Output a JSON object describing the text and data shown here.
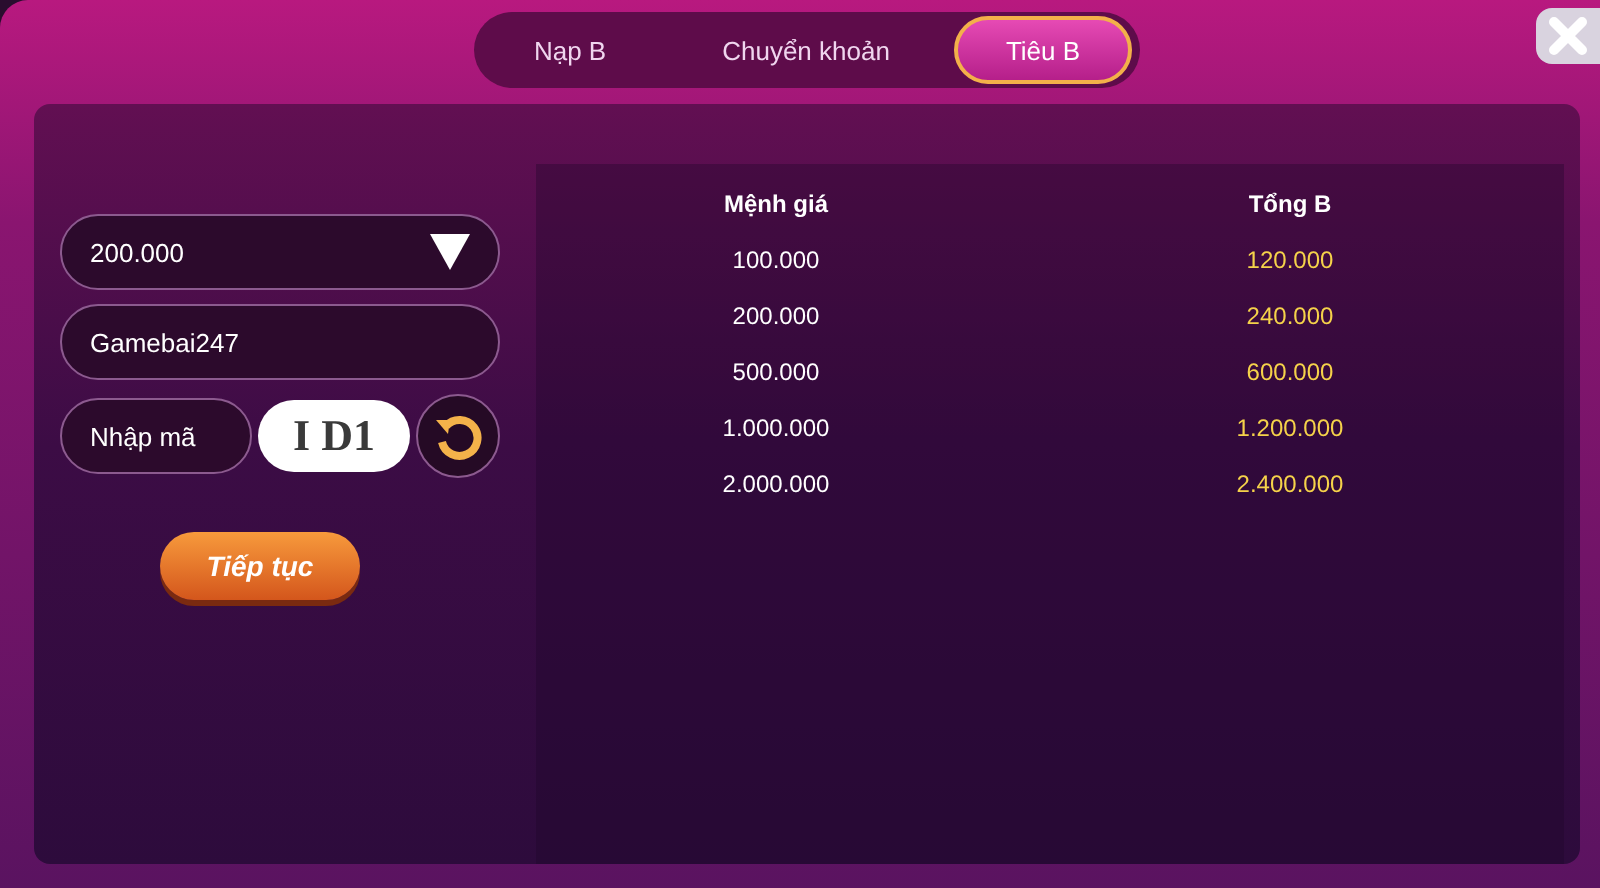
{
  "tabs": [
    {
      "label": "Nạp B",
      "selected": false
    },
    {
      "label": "Chuyển khoản",
      "selected": false
    },
    {
      "label": "Tiêu B",
      "selected": true
    }
  ],
  "form": {
    "amount_select": {
      "value": "200.000"
    },
    "account_field": {
      "value": "Gamebai247"
    },
    "captcha_field": {
      "placeholder": "Nhập mã"
    },
    "captcha_text": "I D1",
    "submit_label": "Tiếp tục"
  },
  "table": {
    "columns": [
      "Mệnh giá",
      "Tổng B"
    ],
    "rows": [
      [
        "100.000",
        "120.000"
      ],
      [
        "200.000",
        "240.000"
      ],
      [
        "500.000",
        "600.000"
      ],
      [
        "1.000.000",
        "1.200.000"
      ],
      [
        "2.000.000",
        "2.400.000"
      ]
    ]
  }
}
